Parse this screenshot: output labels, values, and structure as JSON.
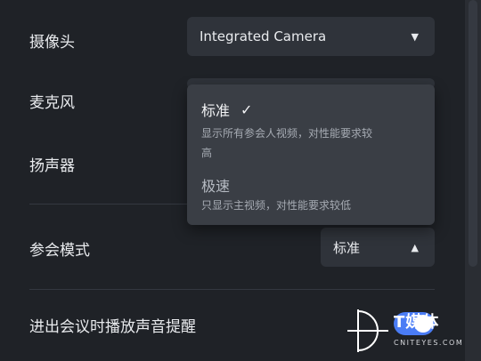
{
  "settings": {
    "camera": {
      "label": "摄像头",
      "value": "Integrated Camera"
    },
    "microphone": {
      "label": "麦克风"
    },
    "speaker": {
      "label": "扬声器"
    },
    "meeting_mode": {
      "label": "参会模式",
      "value": "标准"
    },
    "join_sound": {
      "label": "进出会议时播放声音提醒",
      "enabled": true
    }
  },
  "dropdown": {
    "options": [
      {
        "title": "标准",
        "desc_line1": "显示所有参会人视频，对性能要求较",
        "desc_line2": "高",
        "selected": true
      },
      {
        "title": "极速",
        "desc_line1": "只显示主视频，对性能要求较低",
        "selected": false
      }
    ]
  },
  "watermark": {
    "text": "T媒体",
    "subtext": "CNITEYES.COM"
  },
  "colors": {
    "background": "#1f2227",
    "toggle_on": "#4a7cf5",
    "dropdown_bg": "#3a3e45"
  }
}
